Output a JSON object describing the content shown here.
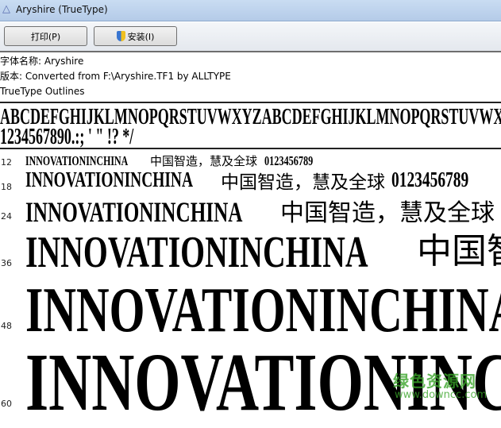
{
  "window": {
    "title": "Aryshire (TrueType)"
  },
  "toolbar": {
    "print_label": "打印(P)",
    "install_label": "安装(I)"
  },
  "info": {
    "font_name": "字体名称: Aryshire",
    "version": "版本: Converted from F:\\Aryshire.TF1 by ALLTYPE",
    "outline": "TrueType Outlines"
  },
  "charset": {
    "line1": "ABCDEFGHIJKLMNOPQRSTUVWXYZABCDEFGHIJKLMNOPQRSTUVWXYZ",
    "line2": "1234567890.:;  ' \" !?     */"
  },
  "samples": [
    {
      "size": "12",
      "latin": "INNOVATIONINCHINA",
      "cjk": "中国智造，慧及全球",
      "digits": "0123456789"
    },
    {
      "size": "18",
      "latin": "INNOVATIONINCHINA",
      "cjk": "中国智造，慧及全球",
      "digits": "0123456789"
    },
    {
      "size": "24",
      "latin": "INNOVATIONINCHINA",
      "cjk": "中国智造，慧及全球"
    },
    {
      "size": "36",
      "latin": "INNOVATIONINCHINA",
      "cjk": "中国智"
    },
    {
      "size": "48",
      "latin": "INNOVATIONINCHINA"
    },
    {
      "size": "60",
      "latin": "INNOVATIONINC"
    }
  ],
  "watermark": {
    "name": "绿色资源网",
    "url": "www.downcc.com"
  }
}
